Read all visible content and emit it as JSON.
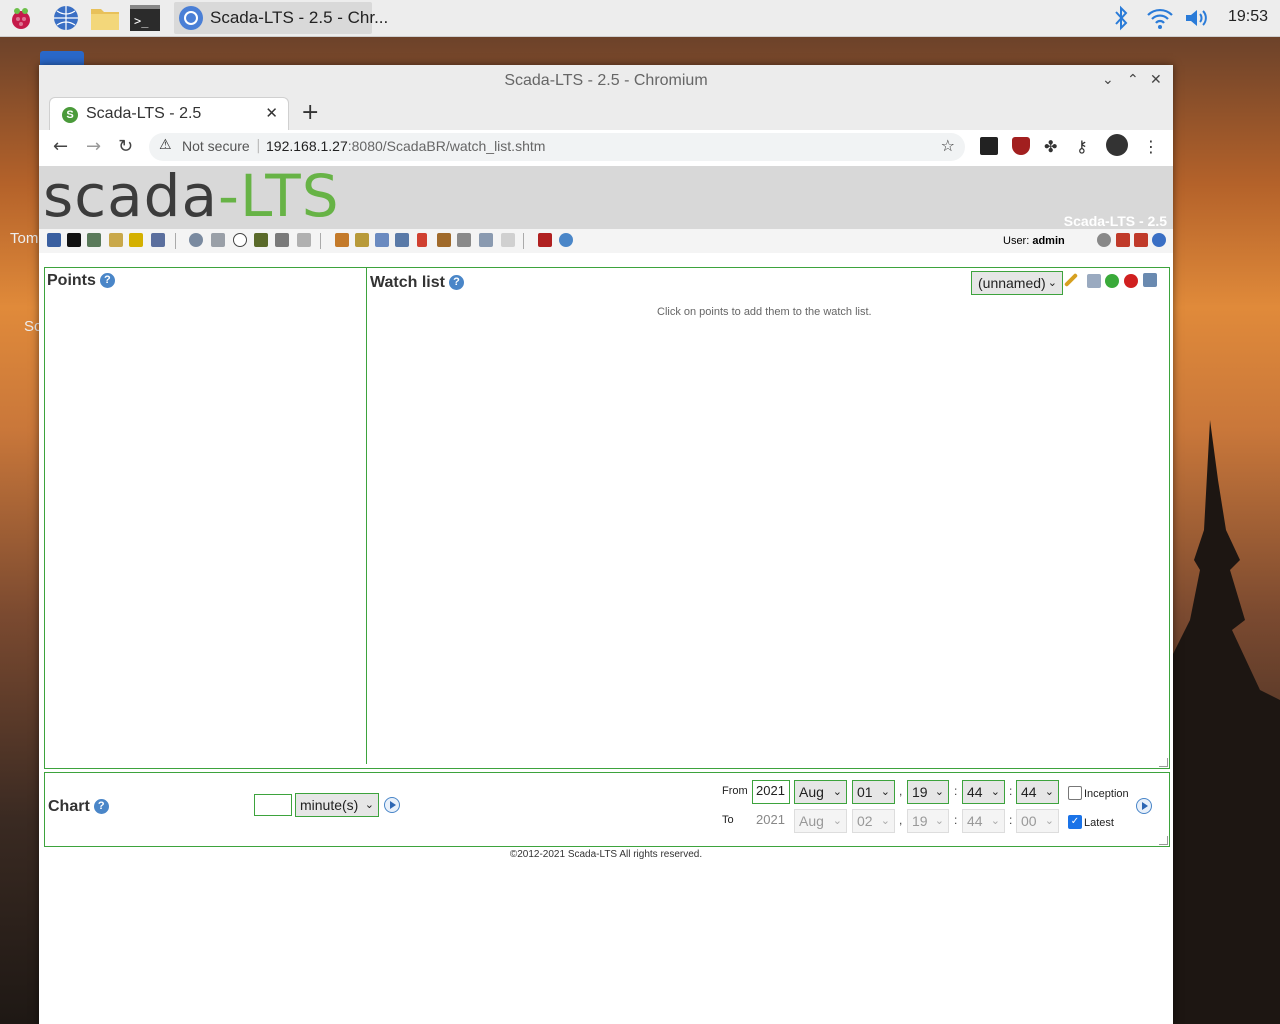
{
  "taskbar": {
    "window_title": "Scada-LTS - 2.5 - Chr...",
    "clock": "19:53",
    "icons": [
      "raspberry-menu-icon",
      "browser-icon",
      "file-manager-icon",
      "terminal-icon",
      "chromium-icon",
      "bluetooth-icon",
      "wifi-icon",
      "volume-icon"
    ]
  },
  "desktop": {
    "label1": "Tom",
    "label2": "Sc"
  },
  "window": {
    "title": "Scada-LTS - 2.5 - Chromium",
    "tab_title": "Scada-LTS - 2.5",
    "favicon_letter": "S",
    "not_secure": "Not secure",
    "url_host": "192.168.1.27",
    "url_rest": ":8080/ScadaBR/watch_list.shtm"
  },
  "app": {
    "logo_part1": "scada",
    "logo_part2": "-LTS",
    "version": "Scada-LTS - 2.5",
    "user_label": "User:",
    "user_name": "admin"
  },
  "points": {
    "title": "Points"
  },
  "watchlist": {
    "title": "Watch list",
    "selected": "(unnamed)",
    "hint": "Click on points to add them to the watch list."
  },
  "chart": {
    "title": "Chart",
    "period_value": "",
    "period_unit": "minute(s)",
    "from_label": "From",
    "to_label": "To",
    "from": {
      "year": "2021",
      "month": "Aug",
      "day": "01",
      "hour": "19",
      "minute": "44",
      "second": "44"
    },
    "to": {
      "year": "2021",
      "month": "Aug",
      "day": "02",
      "hour": "19",
      "minute": "44",
      "second": "00"
    },
    "inception_label": "Inception",
    "inception_checked": false,
    "latest_label": "Latest",
    "latest_checked": true,
    "comma": ",",
    "colon": ":"
  },
  "footer": "©2012-2021 Scada-LTS All rights reserved."
}
